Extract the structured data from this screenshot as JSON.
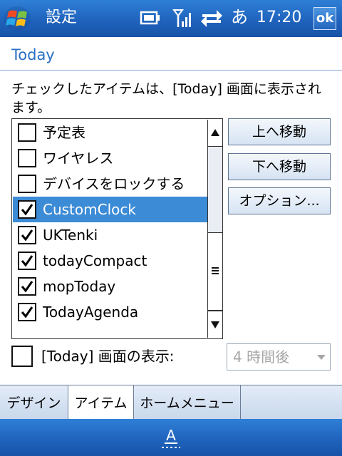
{
  "titlebar": {
    "title": "設定",
    "ime": "あ",
    "time": "17:20",
    "ok_label": "ok"
  },
  "page": {
    "title": "Today",
    "description": "チェックしたアイテムは、[Today] 画面に表示されます。"
  },
  "items": [
    {
      "label": "予定表",
      "checked": false,
      "selected": false
    },
    {
      "label": "ワイヤレス",
      "checked": false,
      "selected": false
    },
    {
      "label": "デバイスをロックする",
      "checked": false,
      "selected": false
    },
    {
      "label": "CustomClock",
      "checked": true,
      "selected": true
    },
    {
      "label": "UKTenki",
      "checked": true,
      "selected": false
    },
    {
      "label": "todayCompact",
      "checked": true,
      "selected": false
    },
    {
      "label": "mopToday",
      "checked": true,
      "selected": false
    },
    {
      "label": "TodayAgenda",
      "checked": true,
      "selected": false
    }
  ],
  "buttons": {
    "move_up": "上へ移動",
    "move_down": "下へ移動",
    "options": "オプション..."
  },
  "display": {
    "label": "[Today] 画面の表示:",
    "checked": false,
    "timeout_value": "4 時間後"
  },
  "tabs": [
    {
      "label": "デザイン",
      "active": false
    },
    {
      "label": "アイテム",
      "active": true
    },
    {
      "label": "ホームメニュー",
      "active": false
    }
  ],
  "colors": {
    "accent": "#1f63bd",
    "selection": "#3c8bd6",
    "page_title": "#2a6fc3"
  }
}
